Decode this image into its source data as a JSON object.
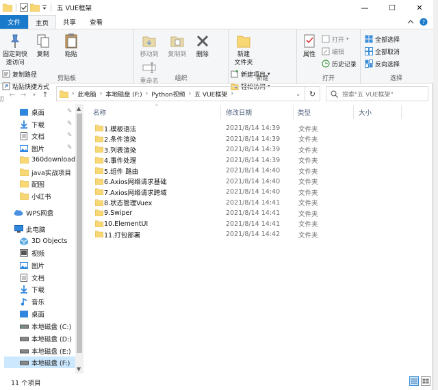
{
  "window": {
    "title": "五 VUE框架",
    "controls": {
      "minimize": "—",
      "maximize": "☐",
      "close": "✕"
    }
  },
  "tabs": {
    "file": "文件",
    "home": "主页",
    "share": "共享",
    "view": "查看"
  },
  "ribbon": {
    "clipboard": {
      "pin": "固定到快\n速访问",
      "copy": "复制",
      "paste": "粘贴",
      "copy_path": "复制路径",
      "paste_shortcut": "粘贴快捷方式",
      "cut": "剪切",
      "group": "剪贴板"
    },
    "organize": {
      "move_to": "移动到",
      "copy_to": "复制到",
      "delete": "删除",
      "rename": "重命名",
      "group": "组织"
    },
    "new": {
      "new_folder": "新建\n文件夹",
      "new_item": "新建项目",
      "easy_access": "轻松访问",
      "group": "新建"
    },
    "open": {
      "properties": "属性",
      "open": "打开",
      "edit": "编辑",
      "history": "历史记录",
      "group": "打开"
    },
    "select": {
      "select_all": "全部选择",
      "select_none": "全部取消",
      "invert": "反向选择",
      "group": "选择"
    }
  },
  "address": {
    "crumbs": [
      "此电脑",
      "本地磁盘 (F:)",
      "Python视频",
      "五 VUE框架"
    ],
    "search_placeholder": "搜索\"五 VUE框架\""
  },
  "nav": {
    "quick": [
      {
        "label": "桌面",
        "icon": "desktop-icon",
        "pinned": true
      },
      {
        "label": "下载",
        "icon": "download-icon",
        "pinned": true
      },
      {
        "label": "文档",
        "icon": "document-icon",
        "pinned": true
      },
      {
        "label": "图片",
        "icon": "picture-icon",
        "pinned": true
      },
      {
        "label": "360downloads",
        "icon": "folder-icon",
        "pinned": false
      },
      {
        "label": "java实战项目",
        "icon": "folder-icon",
        "pinned": false
      },
      {
        "label": "配图",
        "icon": "folder-icon",
        "pinned": false
      },
      {
        "label": "小红书",
        "icon": "folder-icon",
        "pinned": false
      }
    ],
    "wps": "WPS网盘",
    "this_pc": "此电脑",
    "pc_items": [
      {
        "label": "3D Objects",
        "icon": "3d-objects-icon"
      },
      {
        "label": "视频",
        "icon": "video-icon"
      },
      {
        "label": "图片",
        "icon": "picture-icon"
      },
      {
        "label": "文档",
        "icon": "document-icon"
      },
      {
        "label": "下载",
        "icon": "download-icon"
      },
      {
        "label": "音乐",
        "icon": "music-icon"
      },
      {
        "label": "桌面",
        "icon": "desktop-icon"
      },
      {
        "label": "本地磁盘 (C:)",
        "icon": "drive-icon"
      },
      {
        "label": "本地磁盘 (D:)",
        "icon": "drive-icon"
      },
      {
        "label": "本地磁盘 (E:)",
        "icon": "drive-icon"
      },
      {
        "label": "本地磁盘 (F:)",
        "icon": "drive-icon",
        "selected": true
      }
    ]
  },
  "columns": {
    "name": "名称",
    "date": "修改日期",
    "type": "类型",
    "size": "大小"
  },
  "files": [
    {
      "name": "1.模板语法",
      "date": "2021/8/14 14:39",
      "type": "文件夹"
    },
    {
      "name": "2.条件渲染",
      "date": "2021/8/14 14:39",
      "type": "文件夹"
    },
    {
      "name": "3.列表渲染",
      "date": "2021/8/14 14:39",
      "type": "文件夹"
    },
    {
      "name": "4.事件处理",
      "date": "2021/8/14 14:39",
      "type": "文件夹"
    },
    {
      "name": "5.组件  路由",
      "date": "2021/8/14 14:40",
      "type": "文件夹"
    },
    {
      "name": "6.Axios网络请求基础",
      "date": "2021/8/14 14:40",
      "type": "文件夹"
    },
    {
      "name": "7.Axios网络请求跨域",
      "date": "2021/8/14 14:40",
      "type": "文件夹"
    },
    {
      "name": "8.状态管理Vuex",
      "date": "2021/8/14 14:41",
      "type": "文件夹"
    },
    {
      "name": "9.Swiper",
      "date": "2021/8/14 14:41",
      "type": "文件夹"
    },
    {
      "name": "10.ElementUI",
      "date": "2021/8/14 14:41",
      "type": "文件夹"
    },
    {
      "name": "11.打包部署",
      "date": "2021/8/14 14:42",
      "type": "文件夹"
    }
  ],
  "status": {
    "count": "11 个项目"
  },
  "colors": {
    "accent": "#1979ca",
    "folder": "#f8d775",
    "folder_dark": "#e8b84a",
    "selected": "#cce8ff"
  }
}
